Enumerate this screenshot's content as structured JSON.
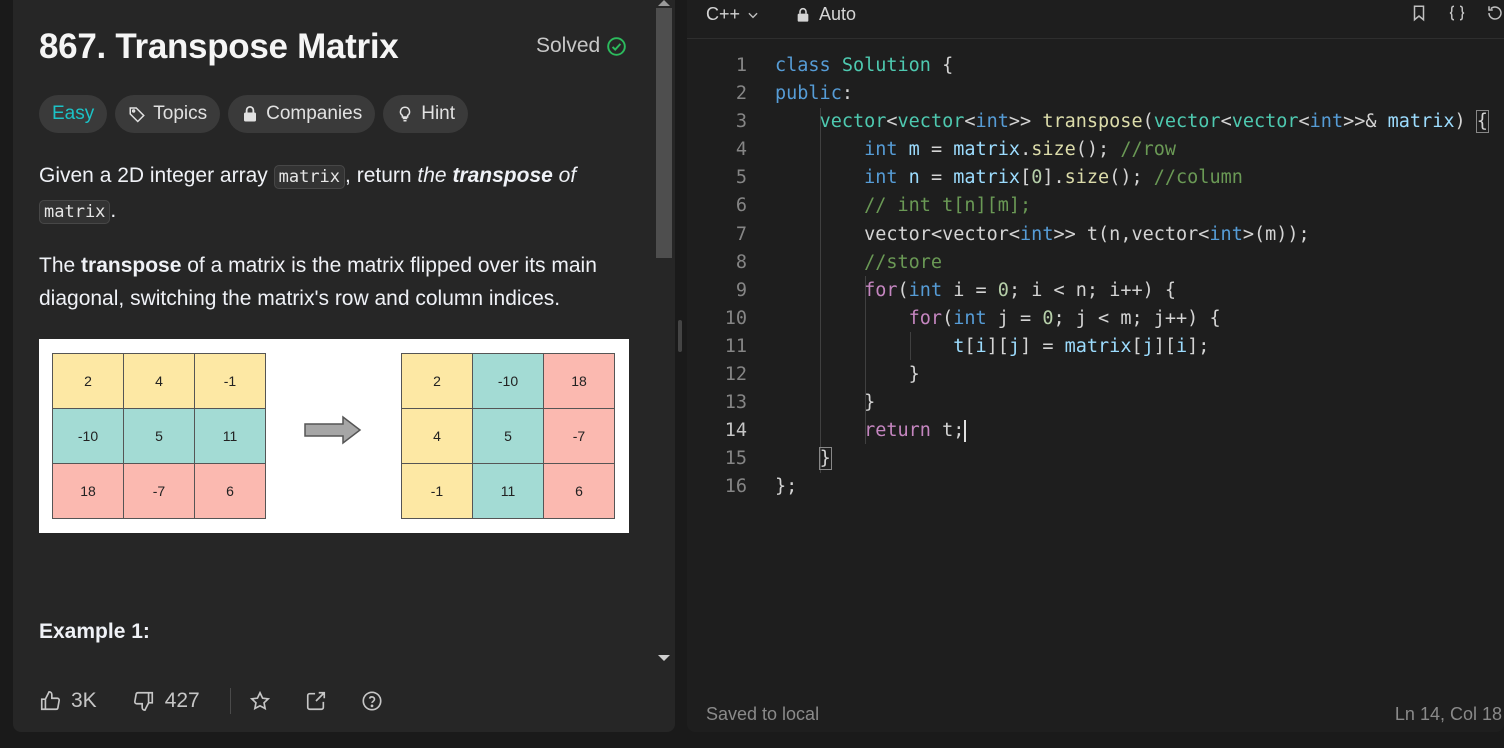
{
  "problem": {
    "title": "867. Transpose Matrix",
    "status": "Solved",
    "tags": {
      "difficulty": "Easy",
      "topics": "Topics",
      "companies": "Companies",
      "hint": "Hint"
    },
    "paragraph1": {
      "pre": "Given a 2D integer array ",
      "code1": "matrix",
      "mid": ", return ",
      "italic1": "the ",
      "bold": "transpose",
      "italic2": " of",
      "code2": "matrix",
      "end": "."
    },
    "paragraph2": {
      "pre": "The ",
      "bold": "transpose",
      "rest": " of a matrix is the matrix flipped over its main diagonal, switching the matrix's row and column indices."
    },
    "example_title": "Example 1:"
  },
  "figure": {
    "matrix_before": [
      [
        "2",
        "4",
        "-1"
      ],
      [
        "-10",
        "5",
        "11"
      ],
      [
        "18",
        "-7",
        "6"
      ]
    ],
    "matrix_after": [
      [
        "2",
        "-10",
        "18"
      ],
      [
        "4",
        "5",
        "-7"
      ],
      [
        "-1",
        "11",
        "6"
      ]
    ],
    "colors": {
      "yellow": "#fde8a4",
      "teal": "#a3dbd4",
      "pink": "#fbb9b0"
    }
  },
  "footer": {
    "likes": "3K",
    "dislikes": "427"
  },
  "editor": {
    "language": "C++",
    "mode": "Auto",
    "saved": "Saved to local",
    "position": "Ln 14, Col 18",
    "line_numbers": [
      "1",
      "2",
      "3",
      "4",
      "5",
      "6",
      "7",
      "8",
      "9",
      "10",
      "11",
      "12",
      "13",
      "14",
      "15",
      "16"
    ]
  },
  "colors": {
    "accent_easy": "#1cc2c6",
    "solved_green": "#2cbb5d"
  }
}
